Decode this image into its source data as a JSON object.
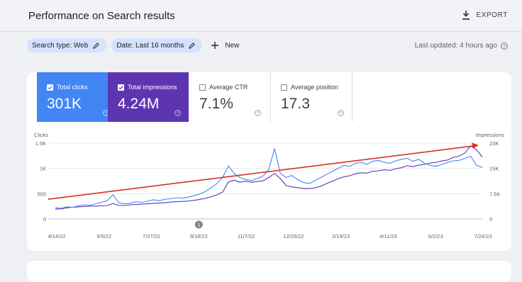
{
  "header": {
    "title": "Performance on Search results",
    "export_label": "EXPORT"
  },
  "filters": {
    "search_type": "Search type: Web",
    "date": "Date: Last 16 months",
    "new_label": "New",
    "last_updated": "Last updated: 4 hours ago"
  },
  "metrics": [
    {
      "label": "Total clicks",
      "value": "301K",
      "selected": true,
      "color": "#4285f4"
    },
    {
      "label": "Total impressions",
      "value": "4.24M",
      "selected": true,
      "color": "#5e35b1"
    },
    {
      "label": "Average CTR",
      "value": "7.1%",
      "selected": false
    },
    {
      "label": "Average position",
      "value": "17.3",
      "selected": false
    }
  ],
  "chart_data": {
    "type": "line",
    "left_axis": {
      "label": "Clicks",
      "ticks": [
        "1.5K",
        "1K",
        "500",
        "0"
      ],
      "values": [
        1500,
        1000,
        500,
        0
      ],
      "ylim": [
        0,
        1500
      ]
    },
    "right_axis": {
      "label": "Impressions",
      "ticks": [
        "23K",
        "15K",
        "7.5K",
        "0"
      ],
      "values": [
        22500,
        15000,
        7500,
        0
      ],
      "ylim": [
        0,
        22500
      ]
    },
    "x_ticks": [
      "4/14/22",
      "6/5/22",
      "7/27/22",
      "9/16/22",
      "11/7/22",
      "12/29/22",
      "2/19/23",
      "4/11/23",
      "6/2/23",
      "7/24/23"
    ],
    "annotation": {
      "label": "1",
      "x_tick_index": 3
    },
    "series": [
      {
        "name": "Clicks",
        "axis": "left",
        "color": "#4285f4",
        "values": [
          220,
          210,
          240,
          230,
          260,
          280,
          270,
          300,
          330,
          360,
          480,
          320,
          300,
          310,
          340,
          330,
          350,
          380,
          360,
          390,
          400,
          420,
          410,
          430,
          460,
          490,
          540,
          620,
          700,
          820,
          1050,
          900,
          820,
          780,
          760,
          800,
          850,
          980,
          1390,
          900,
          820,
          860,
          780,
          720,
          700,
          760,
          820,
          880,
          940,
          1000,
          1060,
          1040,
          1100,
          1120,
          1080,
          1140,
          1160,
          1120,
          1100,
          1150,
          1180,
          1200,
          1140,
          1180,
          1100,
          1060,
          1040,
          1080,
          1120,
          1150,
          1160,
          1200,
          1240,
          1060,
          1020
        ]
      },
      {
        "name": "Impressions",
        "axis": "right",
        "color": "#5e35b1",
        "values": [
          2900,
          3000,
          3300,
          3500,
          3600,
          3700,
          3800,
          3800,
          3900,
          4000,
          4600,
          4000,
          4000,
          4200,
          4300,
          4400,
          4500,
          4600,
          4700,
          4800,
          5000,
          5100,
          5200,
          5300,
          5500,
          5800,
          6100,
          6600,
          7100,
          8000,
          11000,
          11500,
          10900,
          11200,
          10900,
          11100,
          11300,
          12300,
          13500,
          12000,
          9900,
          9500,
          9300,
          9000,
          9000,
          9200,
          9700,
          10500,
          11200,
          11900,
          12500,
          12800,
          13400,
          13700,
          13600,
          14100,
          14300,
          14600,
          14400,
          14900,
          15200,
          15800,
          15500,
          16000,
          16200,
          16600,
          16800,
          17200,
          17500,
          18300,
          18700,
          19600,
          21700,
          20500,
          18400
        ]
      }
    ],
    "trend_annotation": {
      "from_clicks": 390,
      "to_clicks": 1460,
      "color": "#d93025"
    }
  }
}
